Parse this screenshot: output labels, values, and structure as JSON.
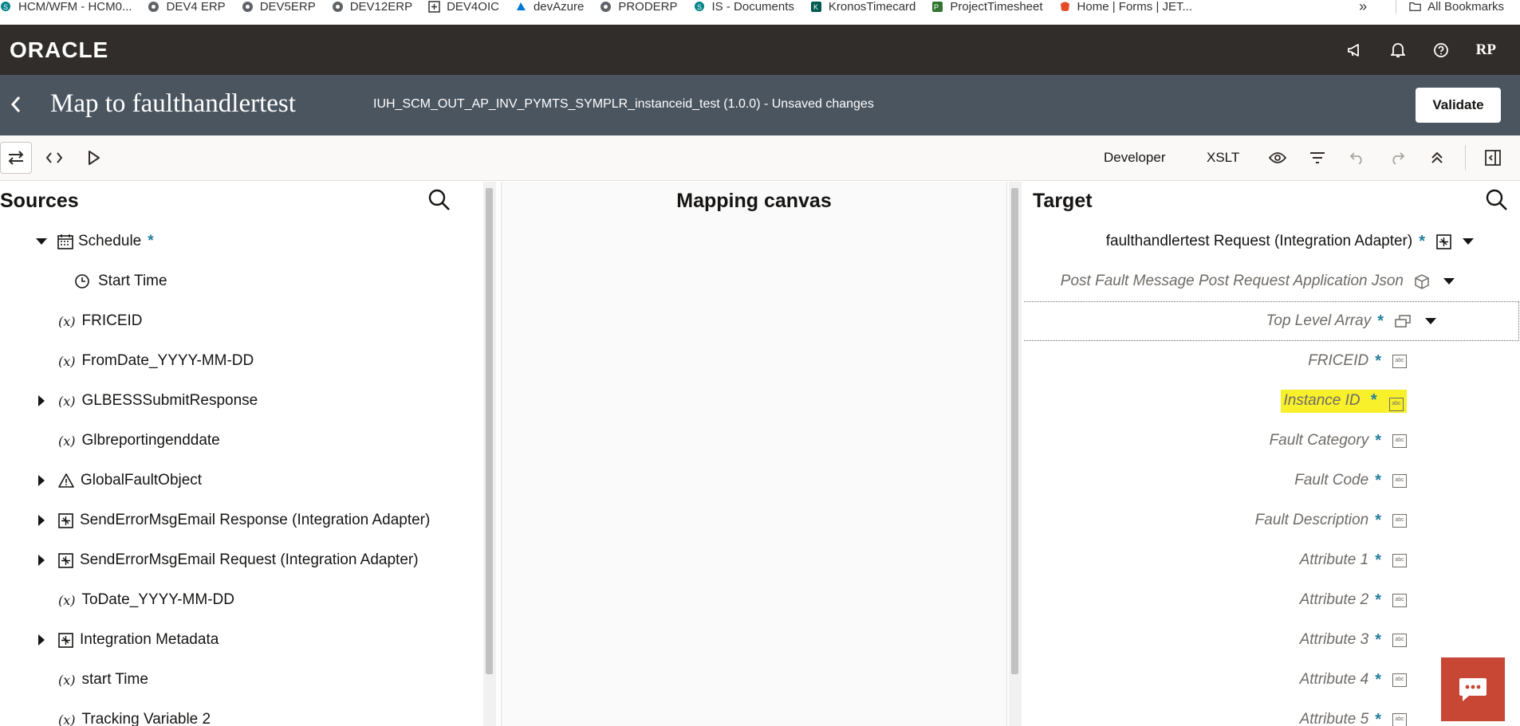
{
  "bookmarks": [
    {
      "label": "HCM/WFM - HCM0...",
      "icon": "sharepoint-icon"
    },
    {
      "label": "DEV4 ERP",
      "icon": "globe-icon"
    },
    {
      "label": "DEV5ERP",
      "icon": "globe-icon"
    },
    {
      "label": "DEV12ERP",
      "icon": "globe-icon"
    },
    {
      "label": "DEV4OIC",
      "icon": "integration-icon"
    },
    {
      "label": "devAzure",
      "icon": "azure-icon"
    },
    {
      "label": "PRODERP",
      "icon": "globe-icon"
    },
    {
      "label": "IS - Documents",
      "icon": "sharepoint-icon"
    },
    {
      "label": "KronosTimecard",
      "icon": "kronos-icon"
    },
    {
      "label": "ProjectTimesheet",
      "icon": "project-icon"
    },
    {
      "label": "Home | Forms | JET...",
      "icon": "jet-icon"
    }
  ],
  "bookmarks_overflow": "»",
  "all_bookmarks": "All Bookmarks",
  "header": {
    "logo": "ORACLE",
    "user_initials": "RP"
  },
  "title_band": {
    "title": "Map to faulthandlertest",
    "subtitle": "IUH_SCM_OUT_AP_INV_PYMTS_SYMPLR_instanceid_test (1.0.0) - Unsaved changes",
    "validate_label": "Validate"
  },
  "toolbar": {
    "developer_label": "Developer",
    "xslt_label": "XSLT"
  },
  "sources": {
    "heading": "Sources",
    "items": [
      {
        "label": "Schedule",
        "required": "*"
      },
      {
        "label": "Start Time"
      },
      {
        "label": "FRICEID",
        "prefix": "(x)"
      },
      {
        "label": "FromDate_YYYY-MM-DD",
        "prefix": "(x)"
      },
      {
        "label": "GLBESSSubmitResponse",
        "prefix": "(x)"
      },
      {
        "label": "Glbreportingenddate",
        "prefix": "(x)"
      },
      {
        "label": "GlobalFaultObject"
      },
      {
        "label": "SendErrorMsgEmail Response (Integration Adapter)"
      },
      {
        "label": "SendErrorMsgEmail Request (Integration Adapter)"
      },
      {
        "label": "ToDate_YYYY-MM-DD",
        "prefix": "(x)"
      },
      {
        "label": "Integration Metadata"
      },
      {
        "label": "start Time",
        "prefix": "(x)"
      },
      {
        "label": "Tracking Variable 2",
        "prefix": "(x)"
      }
    ]
  },
  "canvas": {
    "heading": "Mapping canvas"
  },
  "target": {
    "heading": "Target",
    "items": [
      {
        "label": "faulthandlertest Request (Integration Adapter)",
        "required": "*"
      },
      {
        "label": "Post Fault Message Post Request Application Json"
      },
      {
        "label": "Top Level Array",
        "required": "*"
      },
      {
        "label": "FRICEID",
        "required": "*"
      },
      {
        "label": "Instance ID",
        "required": "*"
      },
      {
        "label": "Fault Category",
        "required": "*"
      },
      {
        "label": "Fault Code",
        "required": "*"
      },
      {
        "label": "Fault Description",
        "required": "*"
      },
      {
        "label": "Attribute 1",
        "required": "*"
      },
      {
        "label": "Attribute 2",
        "required": "*"
      },
      {
        "label": "Attribute 3",
        "required": "*"
      },
      {
        "label": "Attribute 4",
        "required": "*"
      },
      {
        "label": "Attribute 5",
        "required": "*"
      }
    ]
  },
  "abc_glyph": "abc",
  "colors": {
    "header_bg": "#312d2a",
    "title_band_bg": "#4b5560",
    "required_star": "#227e9e",
    "highlight": "#f8f02a",
    "chat_button": "#c74634"
  }
}
